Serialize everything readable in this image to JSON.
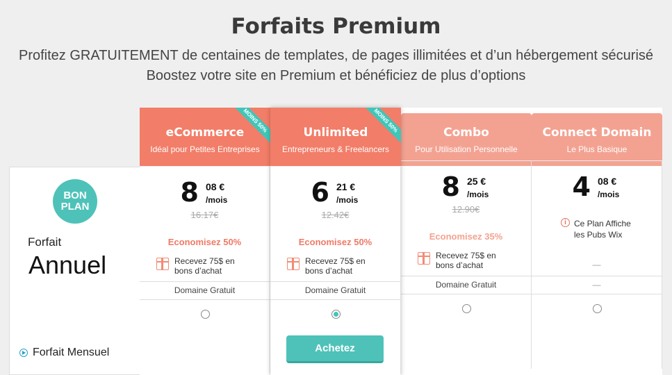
{
  "header": {
    "title": "Forfaits Premium",
    "subtitle1": "Profitez GRATUITEMENT de centaines de templates, de pages illimitées et d’un hébergement sécurisé",
    "subtitle2": "Boostez votre site en Premium et bénéficiez de plus d’options"
  },
  "left_panel": {
    "badge": "BON PLAN",
    "forfait": "Forfait",
    "annuel": "Annuel",
    "mensuel": "Forfait Mensuel"
  },
  "plans": [
    {
      "name": "eCommerce",
      "desc": "Idéal pour Petites Entreprises",
      "ribbon": "MOINS 50%",
      "price_int": "8",
      "price_dec": "08 €",
      "per": "/mois",
      "old_price": "16.17€",
      "economy": "Economisez 50%",
      "gift": "Recevez 75$ en bons d’achat",
      "domain": "Domaine Gratuit",
      "selected": false
    },
    {
      "name": "Unlimited",
      "desc": "Entrepreneurs & Freelancers",
      "ribbon": "MOINS 50%",
      "price_int": "6",
      "price_dec": "21 €",
      "per": "/mois",
      "old_price": "12.42€",
      "economy": "Economisez 50%",
      "gift": "Recevez 75$ en bons d’achat",
      "domain": "Domaine Gratuit",
      "selected": true
    },
    {
      "name": "Combo",
      "desc": "Pour Utilisation Personnelle",
      "price_int": "8",
      "price_dec": "25 €",
      "per": "/mois",
      "old_price": "12.90€",
      "economy": "Economisez 35%",
      "gift": "Recevez 75$ en bons d’achat",
      "domain": "Domaine Gratuit",
      "selected": false
    },
    {
      "name": "Connect Domain",
      "desc": "Le Plus Basique",
      "price_int": "4",
      "price_dec": "08 €",
      "per": "/mois",
      "info": "Ce Plan Affiche les Pubs Wix",
      "dash1": "—",
      "dash2": "—",
      "selected": false
    }
  ],
  "buy_button": "Achetez",
  "gift_line1": "Recevez 75$ en",
  "gift_line2": "bons d’achat",
  "info_line1": "Ce Plan Affiche",
  "info_line2": "les Pubs Wix"
}
